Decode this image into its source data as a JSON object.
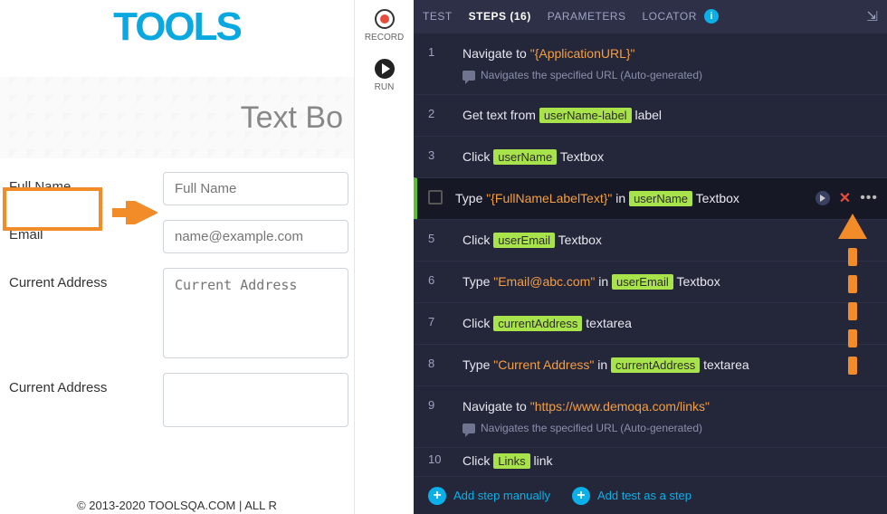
{
  "demo": {
    "logo_text": "TOOLS",
    "hero_title": "Text Bo",
    "labels": {
      "full_name": "Full Name",
      "email": "Email",
      "current_address": "Current Address",
      "current_address2": "Current Address"
    },
    "placeholders": {
      "full_name": "Full Name",
      "email": "name@example.com",
      "current_address": "Current Address"
    },
    "copyright": "© 2013-2020 TOOLSQA.COM | ALL R"
  },
  "toolbar": {
    "record_label": "RECORD",
    "run_label": "RUN"
  },
  "panel": {
    "tabs": {
      "test": "TEST",
      "steps": "STEPS (16)",
      "parameters": "PARAMETERS",
      "locator": "LOCATOR"
    },
    "steps": [
      {
        "num": "1",
        "pre": "Navigate to ",
        "str": "\"{ApplicationURL}\"",
        "post": "",
        "sub": "Navigates the specified URL (Auto-generated)"
      },
      {
        "num": "2",
        "pre": "Get text from ",
        "chip": "userName-label",
        "post": " label"
      },
      {
        "num": "3",
        "pre": "Click ",
        "chip": "userName",
        "post": " Textbox"
      },
      {
        "num": "",
        "pre": "Type ",
        "str": "\"{FullNameLabelText}\"",
        "mid": " in ",
        "chip": "userName",
        "post": " Textbox"
      },
      {
        "num": "5",
        "pre": "Click ",
        "chip": "userEmail",
        "post": " Textbox"
      },
      {
        "num": "6",
        "pre": "Type ",
        "str": "\"Email@abc.com\"",
        "mid": " in ",
        "chip": "userEmail",
        "post": " Textbox"
      },
      {
        "num": "7",
        "pre": "Click ",
        "chip": "currentAddress",
        "post": " textarea"
      },
      {
        "num": "8",
        "pre": "Type ",
        "str": "\"Current Address\"",
        "mid": " in ",
        "chip": "currentAddress",
        "post": " textarea"
      },
      {
        "num": "9",
        "pre": "Navigate to ",
        "str": "\"https://www.demoqa.com/links\"",
        "post": "",
        "sub": "Navigates the specified URL (Auto-generated)"
      },
      {
        "num": "10",
        "pre": "Click ",
        "chip": "Links",
        "post": " link"
      }
    ],
    "footer": {
      "add_step": "Add step manually",
      "add_test": "Add test as a step"
    }
  }
}
